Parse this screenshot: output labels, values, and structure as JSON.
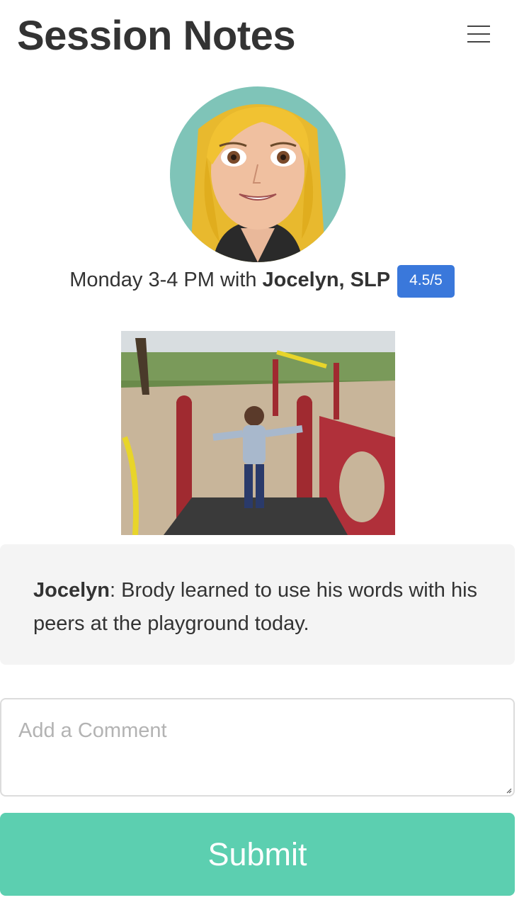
{
  "header": {
    "title": "Session Notes",
    "menu_icon": "hamburger-menu-icon"
  },
  "session": {
    "time_text": "Monday 3-4 PM with",
    "therapist": "Jocelyn, SLP",
    "rating": "4.5/5",
    "accent_color": "#3a78db"
  },
  "note": {
    "author": "Jocelyn",
    "separator": ":",
    "text": " Brody learned to use his words with his peers at the playground today."
  },
  "comment": {
    "placeholder": "Add a Comment",
    "value": ""
  },
  "submit": {
    "label": "Submit",
    "color": "#5ccfb0"
  }
}
